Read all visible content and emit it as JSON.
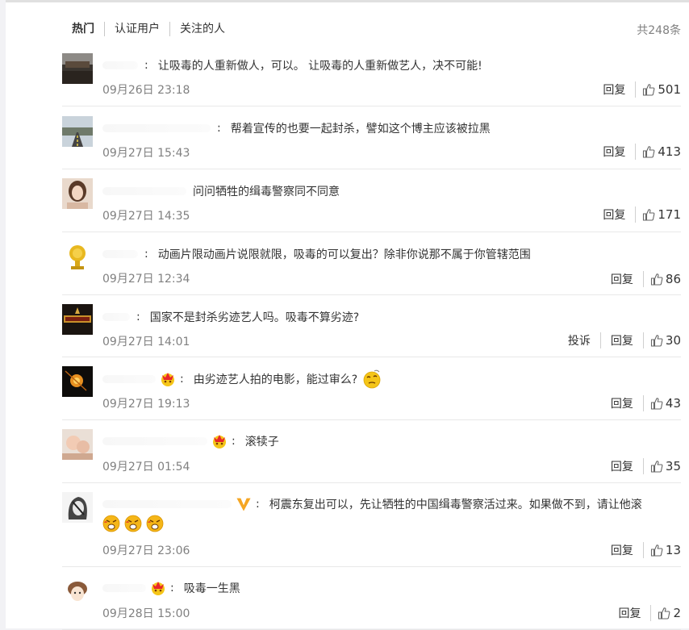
{
  "tabs": [
    "热门",
    "认证用户",
    "关注的人"
  ],
  "total": "共248条",
  "reply_label": "回复",
  "report_label": "投诉",
  "comments": [
    {
      "text": "让吸毒的人重新做人，可以。 让吸毒的人重新做艺人，决不可能!",
      "time": "09月26日 23:18",
      "likes": "501"
    },
    {
      "text": "帮着宣传的也要一起封杀，譬如这个博主应该被拉黑",
      "time": "09月27日 15:43",
      "likes": "413"
    },
    {
      "text": "问问牺牲的缉毒警察同不同意",
      "time": "09月27日 14:35",
      "likes": "171"
    },
    {
      "text": "动画片限动画片说限就限，吸毒的可以复出？除非你说那不属于你管辖范围",
      "time": "09月27日 12:34",
      "likes": "86"
    },
    {
      "text": "国家不是封杀劣迹艺人吗。吸毒不算劣迹?",
      "time": "09月27日 14:01",
      "likes": "30"
    },
    {
      "text": "由劣迹艺人拍的电影，能过审么?",
      "time": "09月27日 19:13",
      "likes": "43"
    },
    {
      "text": "滚犊子",
      "time": "09月27日 01:54",
      "likes": "35"
    },
    {
      "text": "柯震东复出可以，先让牺牲的中国缉毒警察活过来。如果做不到，请让他滚",
      "time": "09月27日 23:06",
      "likes": "13"
    },
    {
      "text": "吸毒一生黑",
      "time": "09月28日 15:00",
      "likes": "2"
    }
  ],
  "icons": {
    "like": "thumbs-up-icon",
    "crown": "crown-badge-icon",
    "vip": "v-verified-icon",
    "thinking": "thinking-emoji-icon",
    "angry": "angry-emoji-icon"
  }
}
